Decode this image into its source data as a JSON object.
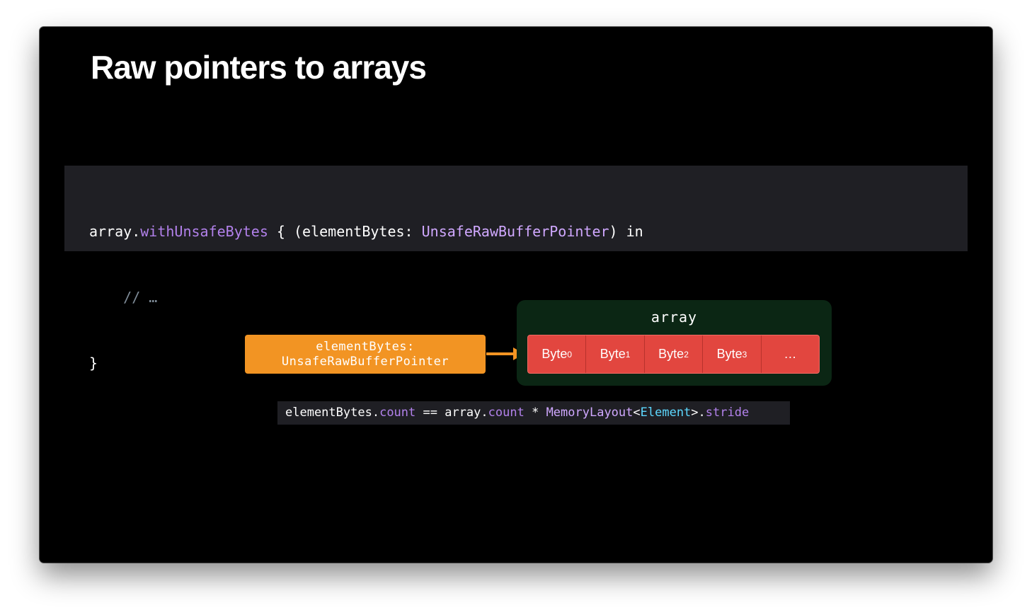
{
  "slide": {
    "title": "Raw pointers to arrays"
  },
  "code": {
    "line1": {
      "receiver": "array",
      "dot": ".",
      "method": "withUnsafeBytes",
      "open": " { (elementBytes: ",
      "type": "UnsafeRawBufferPointer",
      "close": ") in"
    },
    "line2": "    // …",
    "line3": "}"
  },
  "diagram": {
    "pointer_label_line1": "elementBytes:",
    "pointer_label_line2": "UnsafeRawBufferPointer",
    "array_label": "array",
    "bytes": [
      {
        "base": "Byte",
        "sub": "0"
      },
      {
        "base": "Byte",
        "sub": "1"
      },
      {
        "base": "Byte",
        "sub": "2"
      },
      {
        "base": "Byte",
        "sub": "3"
      }
    ],
    "ellipsis": "…"
  },
  "formula": {
    "lhs_receiver": "elementBytes",
    "dot1": ".",
    "lhs_prop": "count",
    "eq": " == ",
    "rhs_receiver": "array",
    "dot2": ".",
    "rhs_prop": "count",
    "mul": " * ",
    "layout_type": "MemoryLayout",
    "lt": "<",
    "generic": "Element",
    "gt": ">",
    "dot3": ".",
    "stride": "stride"
  },
  "colors": {
    "background": "#000000",
    "code_block": "#1f1f24",
    "keyword_purple": "#b281eb",
    "pointer_orange": "#f29423",
    "byte_red": "#e2463f",
    "array_green": "#0b2614",
    "generic_cyan": "#5dd8ff"
  }
}
